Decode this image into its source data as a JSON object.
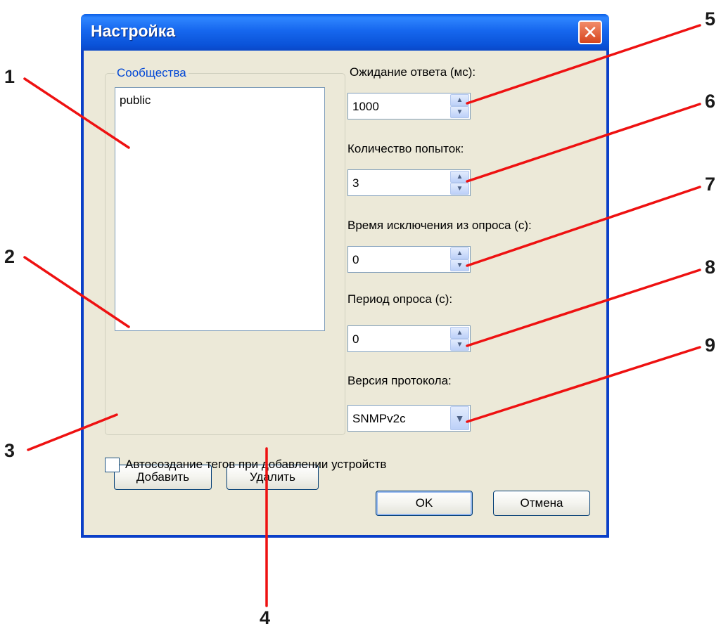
{
  "window": {
    "title": "Настройка",
    "close_glyph": "✕"
  },
  "communities": {
    "legend": "Сообщества",
    "items": [
      "public"
    ],
    "add_label": "Добавить",
    "delete_label": "Удалить"
  },
  "settings": {
    "timeout": {
      "label": "Ожидание ответа (мс):",
      "value": "1000"
    },
    "retries": {
      "label": "Количество попыток:",
      "value": "3"
    },
    "exclusion_time": {
      "label": "Время исключения из опроса (с):",
      "value": "0"
    },
    "poll_period": {
      "label": "Период опроса (с):",
      "value": "0"
    },
    "protocol": {
      "label": "Версия протокола:",
      "value": "SNMPv2c"
    }
  },
  "auto_create": {
    "label": "Автосоздание тегов при добавлении устройств",
    "checked": false
  },
  "footer": {
    "ok_label": "OK",
    "cancel_label": "Отмена"
  },
  "callouts": [
    "1",
    "2",
    "3",
    "4",
    "5",
    "6",
    "7",
    "8",
    "9"
  ],
  "colors": {
    "callout_line": "#ee1111",
    "titlebar": "#0a52d8",
    "dialog_bg": "#ece9d8",
    "legend_text": "#0046d5"
  },
  "icons": {
    "spin_up": "up-arrow-icon",
    "spin_down": "down-arrow-icon",
    "combo": "chevron-down-icon",
    "close": "close-icon"
  }
}
